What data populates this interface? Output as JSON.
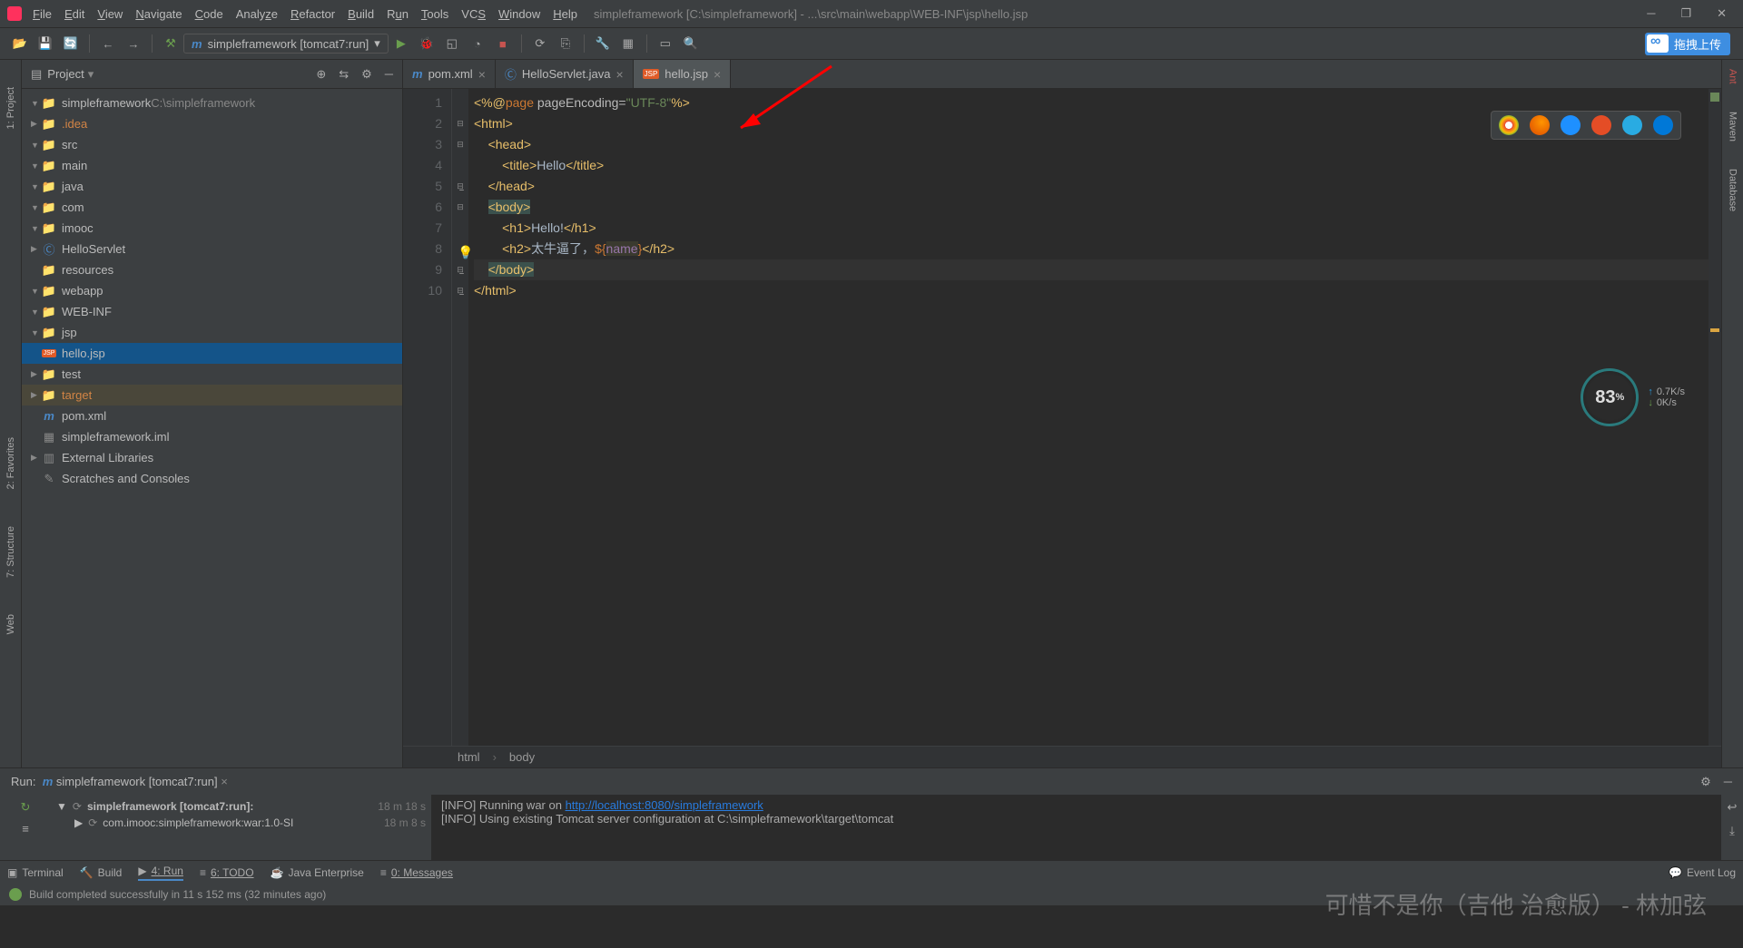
{
  "titlebar": {
    "menus": [
      "File",
      "Edit",
      "View",
      "Navigate",
      "Code",
      "Analyze",
      "Refactor",
      "Build",
      "Run",
      "Tools",
      "VCS",
      "Window",
      "Help"
    ],
    "title": "simpleframework [C:\\simpleframework] - ...\\src\\main\\webapp\\WEB-INF\\jsp\\hello.jsp"
  },
  "toolbar": {
    "runconfig": "simpleframework [tomcat7:run]",
    "upload": "拖拽上传"
  },
  "project": {
    "title": "Project",
    "tree": [
      {
        "d": 0,
        "e": "▼",
        "i": "folder",
        "t": "simpleframework",
        "suf": "  C:\\simpleframework"
      },
      {
        "d": 1,
        "e": "▶",
        "i": "folder",
        "t": ".idea",
        "cls": "orange"
      },
      {
        "d": 1,
        "e": "▼",
        "i": "folder",
        "t": "src"
      },
      {
        "d": 2,
        "e": "▼",
        "i": "folder",
        "t": "main"
      },
      {
        "d": 3,
        "e": "▼",
        "i": "folder",
        "t": "java"
      },
      {
        "d": 4,
        "e": "▼",
        "i": "folder",
        "t": "com"
      },
      {
        "d": 5,
        "e": "▼",
        "i": "folder",
        "t": "imooc"
      },
      {
        "d": 6,
        "e": "▶",
        "i": "class",
        "t": "HelloServlet"
      },
      {
        "d": 3,
        "e": "",
        "i": "folder",
        "t": "resources"
      },
      {
        "d": 3,
        "e": "▼",
        "i": "folder",
        "t": "webapp"
      },
      {
        "d": 4,
        "e": "▼",
        "i": "folder",
        "t": "WEB-INF"
      },
      {
        "d": 5,
        "e": "▼",
        "i": "folder",
        "t": "jsp"
      },
      {
        "d": 6,
        "e": "",
        "i": "jsp",
        "t": "hello.jsp",
        "sel": true
      },
      {
        "d": 2,
        "e": "▶",
        "i": "folder",
        "t": "test"
      },
      {
        "d": 1,
        "e": "▶",
        "i": "folder",
        "t": "target",
        "cls": "orange",
        "hi": true
      },
      {
        "d": 1,
        "e": "",
        "i": "m",
        "t": "pom.xml"
      },
      {
        "d": 1,
        "e": "",
        "i": "iml",
        "t": "simpleframework.iml"
      },
      {
        "d": 0,
        "e": "▶",
        "i": "lib",
        "t": "External Libraries"
      },
      {
        "d": 0,
        "e": "",
        "i": "scratch",
        "t": "Scratches and Consoles"
      }
    ]
  },
  "tabs": [
    {
      "icon": "m",
      "label": "pom.xml",
      "active": false
    },
    {
      "icon": "c",
      "label": "HelloServlet.java",
      "active": false
    },
    {
      "icon": "jsp",
      "label": "hello.jsp",
      "active": true
    }
  ],
  "code": {
    "lines": [
      1,
      2,
      3,
      4,
      5,
      6,
      7,
      8,
      9,
      10
    ]
  },
  "breadcrumb": [
    "html",
    "body"
  ],
  "speed": {
    "pct": "83",
    "unit": "%",
    "up": "0.7K/s",
    "down": "0K/s"
  },
  "runhdr": {
    "label": "Run:",
    "name": "simpleframework [tomcat7:run]"
  },
  "runtree": [
    {
      "t": "simpleframework [tomcat7:run]:",
      "time": "18 m 18 s"
    },
    {
      "t": "com.imooc:simpleframework:war:1.0-SI",
      "time": "18 m 8 s"
    }
  ],
  "runout": {
    "l1a": "[INFO] Running war on ",
    "l1b": "http://localhost:8080/simpleframework",
    "l2": "[INFO] Using existing Tomcat server configuration at C:\\simpleframework\\target\\tomcat"
  },
  "bottombar": {
    "terminal": "Terminal",
    "build": "Build",
    "run": "4: Run",
    "todo": "6: TODO",
    "je": "Java Enterprise",
    "msg": "0: Messages",
    "event": "Event Log"
  },
  "statusbar": {
    "msg": "Build completed successfully in 11 s 152 ms (32 minutes ago)"
  },
  "leftstrip": [
    "1: Project",
    "2: Favorites",
    "7: Structure",
    "Web"
  ],
  "rightstrip": [
    "Ant",
    "Maven",
    "Database"
  ],
  "watermark": "可惜不是你（吉他 治愈版）   -   林加弦"
}
